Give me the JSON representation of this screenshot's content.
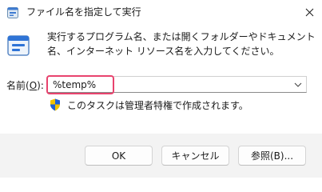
{
  "window": {
    "title": "ファイル名を指定して実行",
    "app_icon": "run-dialog-icon",
    "close_icon": "close-icon"
  },
  "dialog": {
    "description": "実行するプログラム名、または開くフォルダーやドキュメント名、インターネット リソース名を入力してください。",
    "open_label_text": "名前(",
    "open_label_key": "O",
    "open_label_suffix": "):",
    "open_value": "%temp%",
    "admin_note": "このタスクは管理者特権で作成されます。"
  },
  "buttons": {
    "ok": "OK",
    "cancel": "キャンセル",
    "browse": "参照(B)..."
  },
  "colors": {
    "highlight": "#e8436e",
    "shield_blue": "#1e5fd6",
    "shield_yellow": "#f2c200"
  }
}
